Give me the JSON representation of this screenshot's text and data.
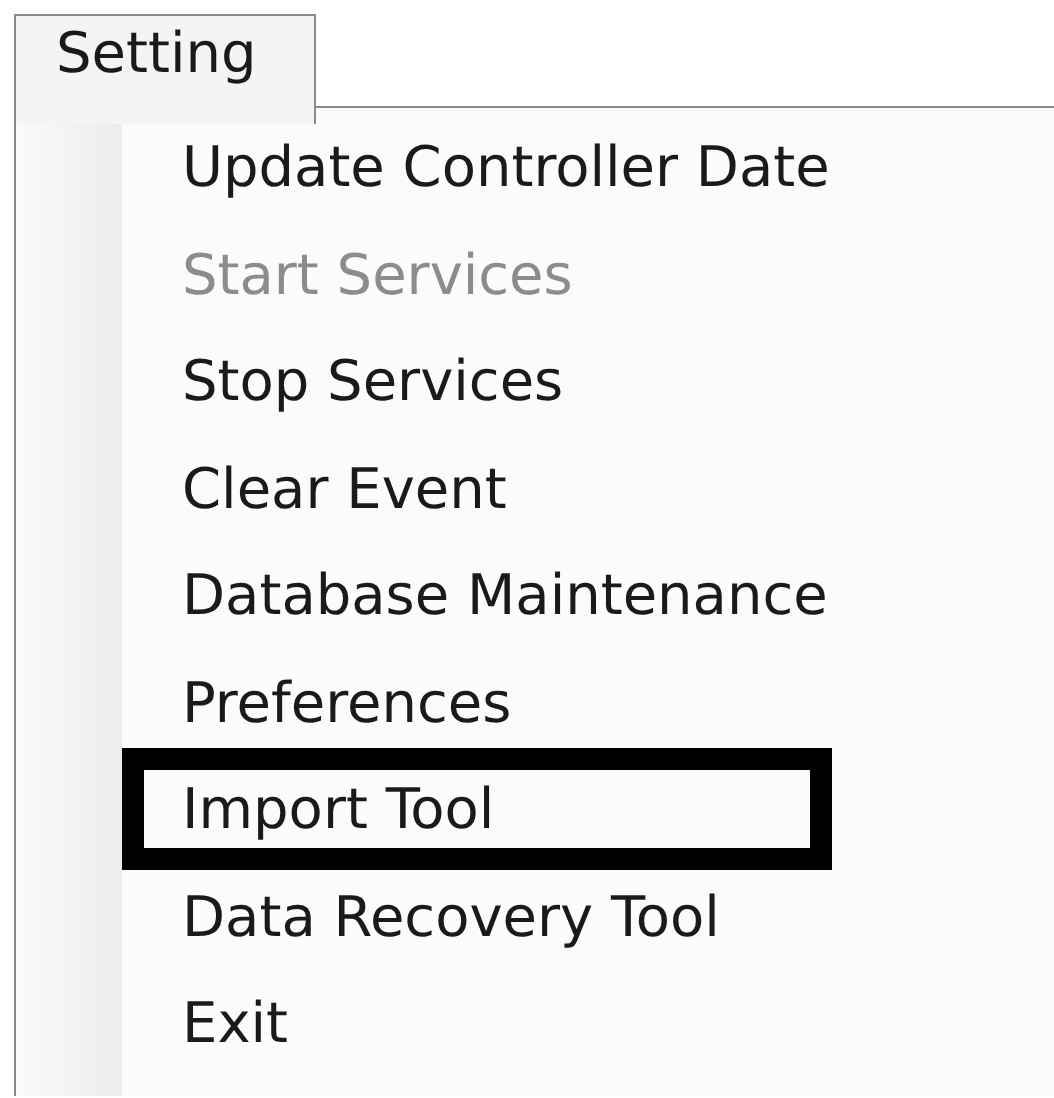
{
  "menu_bar": [
    {
      "label": "Setting",
      "selected": true
    }
  ],
  "menu": {
    "items": [
      {
        "label": "Update Controller Date",
        "disabled": false,
        "highlighted": false
      },
      {
        "label": "Start Services",
        "disabled": true,
        "highlighted": false
      },
      {
        "label": "Stop Services",
        "disabled": false,
        "highlighted": false
      },
      {
        "label": "Clear Event",
        "disabled": false,
        "highlighted": false
      },
      {
        "label": "Database Maintenance",
        "disabled": false,
        "highlighted": false
      },
      {
        "label": "Preferences",
        "disabled": false,
        "highlighted": false
      },
      {
        "label": "Import Tool",
        "disabled": false,
        "highlighted": true
      },
      {
        "label": "Data Recovery Tool",
        "disabled": false,
        "highlighted": false
      },
      {
        "label": "Exit",
        "disabled": false,
        "highlighted": false
      }
    ]
  }
}
